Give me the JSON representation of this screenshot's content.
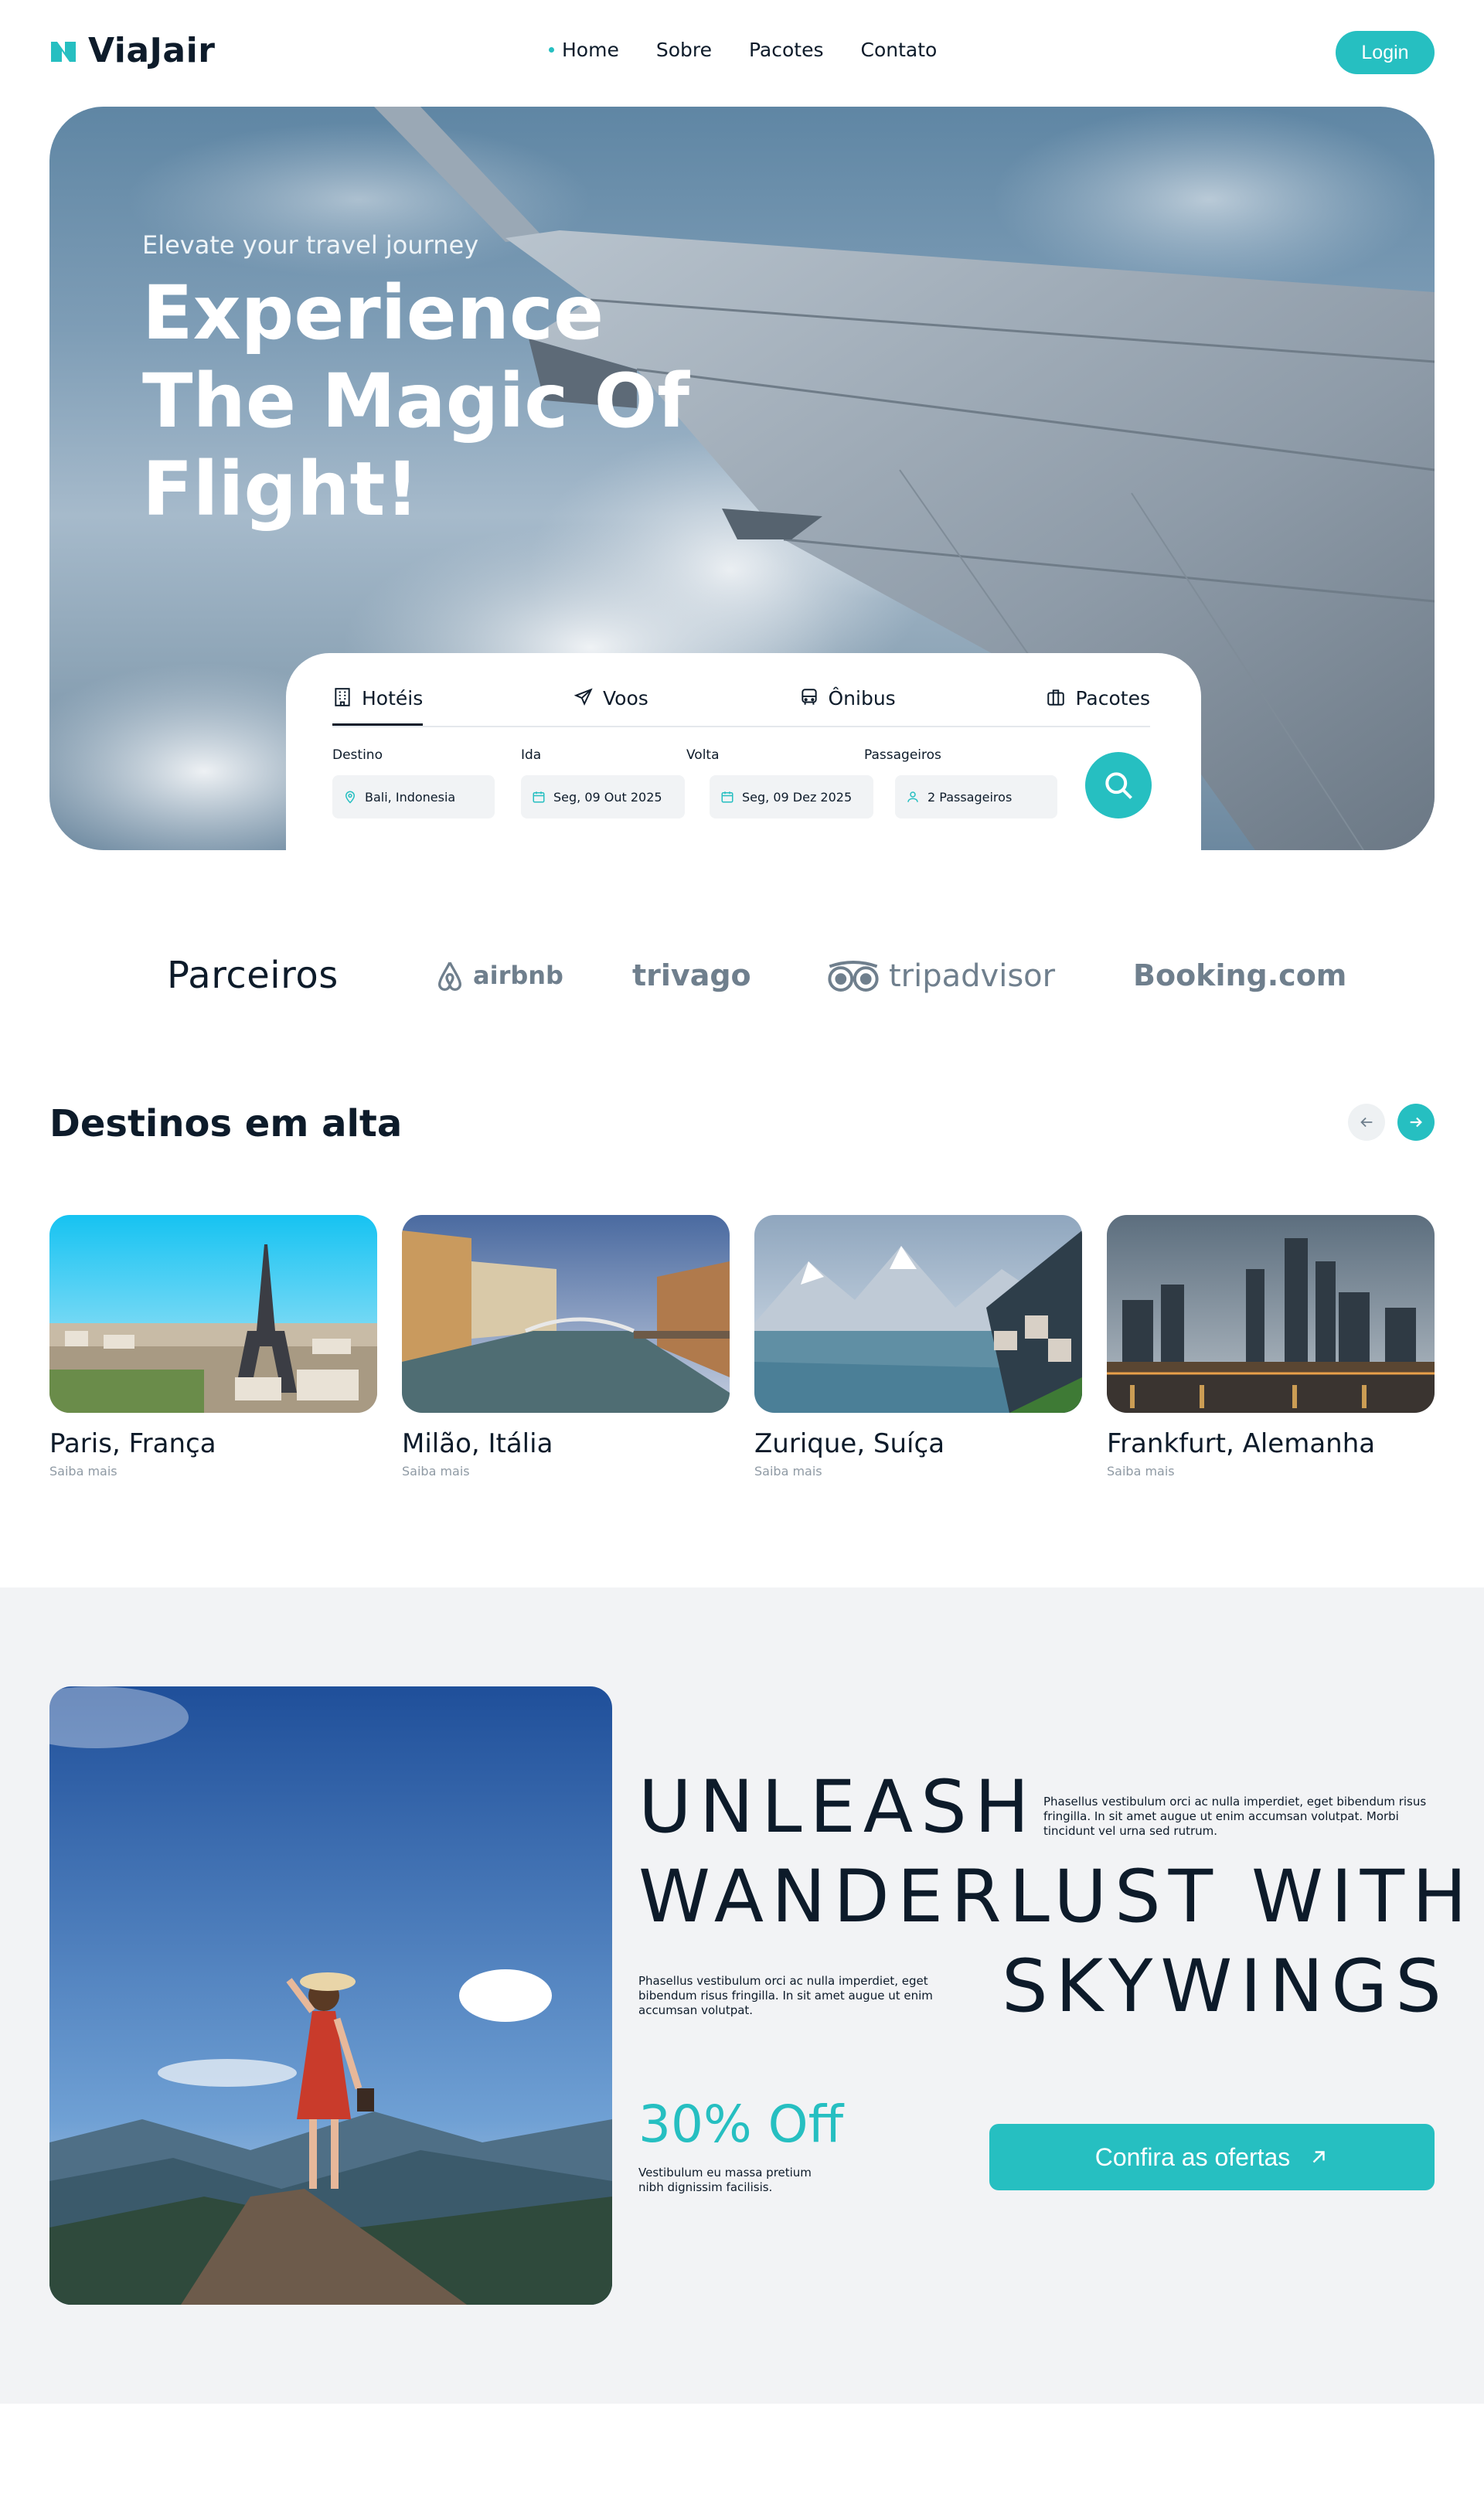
{
  "brand": {
    "name": "ViaJair",
    "accent": "#26bfc1",
    "dark": "#0d1b2a"
  },
  "nav": {
    "items": [
      {
        "label": "Home",
        "active": true
      },
      {
        "label": "Sobre"
      },
      {
        "label": "Pacotes"
      },
      {
        "label": "Contato"
      }
    ],
    "login_label": "Login"
  },
  "hero": {
    "kicker": "Elevate your travel journey",
    "title_lines": [
      "Experience",
      "The Magic Of",
      "Flight!"
    ]
  },
  "search": {
    "tabs": [
      {
        "label": "Hotéis",
        "icon": "building-icon",
        "active": true
      },
      {
        "label": "Voos",
        "icon": "plane-icon"
      },
      {
        "label": "Ônibus",
        "icon": "bus-icon"
      },
      {
        "label": "Pacotes",
        "icon": "suitcase-icon"
      }
    ],
    "fields": [
      {
        "label": "Destino",
        "value": "Bali, Indonesia",
        "icon": "map-pin-icon"
      },
      {
        "label": "Ida",
        "value": "Seg, 09 Out 2025",
        "icon": "calendar-icon"
      },
      {
        "label": "Volta",
        "value": "Seg, 09 Dez 2025",
        "icon": "calendar-icon"
      },
      {
        "label": "Passageiros",
        "value": "2 Passageiros",
        "icon": "user-icon"
      }
    ],
    "button_icon": "search-icon"
  },
  "partners": {
    "title": "Parceiros",
    "logos": [
      "airbnb",
      "trivago",
      "tripadvisor",
      "Booking.com"
    ]
  },
  "destinations": {
    "title": "Destinos em alta",
    "more_label": "Saiba mais",
    "items": [
      {
        "name": "Paris, França"
      },
      {
        "name": "Milão, Itália"
      },
      {
        "name": "Zurique, Suíça"
      },
      {
        "name": "Frankfurt, Alemanha"
      }
    ]
  },
  "promo": {
    "headline": [
      "UNLEASH",
      "WANDERLUST WITH",
      "SKYWINGS"
    ],
    "paragraph_top": "Phasellus vestibulum orci ac nulla imperdiet, eget bibendum risus fringilla. In sit amet augue ut enim accumsan volutpat. Morbi tincidunt vel urna sed rutrum.",
    "paragraph_mid": "Phasellus vestibulum orci ac nulla imperdiet, eget bibendum risus fringilla. In sit amet augue ut enim accumsan volutpat.",
    "discount": "30% Off",
    "paragraph_bottom": "Vestibulum eu massa pretium nibh dignissim facilisis.",
    "cta_label": "Confira as ofertas"
  }
}
